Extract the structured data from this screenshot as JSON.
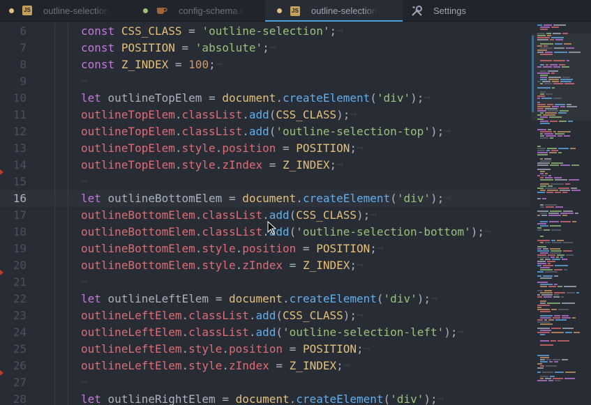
{
  "tabs": [
    {
      "label": "outline-selection.js",
      "icon": "js-file-icon",
      "modified": true,
      "active": false
    },
    {
      "label": "config-schema.coffee",
      "icon": "coffee-file-icon",
      "modified": true,
      "active": false
    },
    {
      "label": "outline-selection.js",
      "icon": "js-file-icon",
      "modified": true,
      "active": true
    },
    {
      "label": "Settings",
      "icon": "tools-icon",
      "modified": false,
      "active": false
    }
  ],
  "editor": {
    "current_line": 16,
    "lines": [
      {
        "n": "6",
        "text": "const CSS_CLASS = 'outline-selection';"
      },
      {
        "n": "7",
        "text": "const POSITION = 'absolute';"
      },
      {
        "n": "8",
        "text": "const Z_INDEX = 100;"
      },
      {
        "n": "9",
        "text": ""
      },
      {
        "n": "10",
        "text": "let outlineTopElem = document.createElement('div');"
      },
      {
        "n": "11",
        "text": "outlineTopElem.classList.add(CSS_CLASS);"
      },
      {
        "n": "12",
        "text": "outlineTopElem.classList.add('outline-selection-top');"
      },
      {
        "n": "13",
        "text": "outlineTopElem.style.position = POSITION;"
      },
      {
        "n": "14",
        "text": "outlineTopElem.style.zIndex = Z_INDEX;"
      },
      {
        "n": "15",
        "text": ""
      },
      {
        "n": "16",
        "text": "let outlineBottomElem = document.createElement('div');"
      },
      {
        "n": "17",
        "text": "outlineBottomElem.classList.add(CSS_CLASS);"
      },
      {
        "n": "18",
        "text": "outlineBottomElem.classList.add('outline-selection-bottom');"
      },
      {
        "n": "19",
        "text": "outlineBottomElem.style.position = POSITION;"
      },
      {
        "n": "20",
        "text": "outlineBottomElem.style.zIndex = Z_INDEX;"
      },
      {
        "n": "21",
        "text": ""
      },
      {
        "n": "22",
        "text": "let outlineLeftElem = document.createElement('div');"
      },
      {
        "n": "23",
        "text": "outlineLeftElem.classList.add(CSS_CLASS);"
      },
      {
        "n": "24",
        "text": "outlineLeftElem.classList.add('outline-selection-left');"
      },
      {
        "n": "25",
        "text": "outlineLeftElem.style.position = POSITION;"
      },
      {
        "n": "26",
        "text": "outlineLeftElem.style.zIndex = Z_INDEX;"
      },
      {
        "n": "27",
        "text": ""
      },
      {
        "n": "28",
        "text": "let outlineRightElem = document.createElement('div');"
      }
    ]
  },
  "colors": {
    "background": "#282c34",
    "tab_bar": "#21252b",
    "modified_dot": "#e5c07b",
    "modified_dot_alt": "#98c379",
    "active_tab_underline": "#4d9fe0",
    "keyword": "#c678dd",
    "string": "#98c379",
    "number": "#d19a66",
    "variable": "#e06c75",
    "function": "#61afef",
    "object": "#e5c07b",
    "git_marker": "#c0392b"
  }
}
